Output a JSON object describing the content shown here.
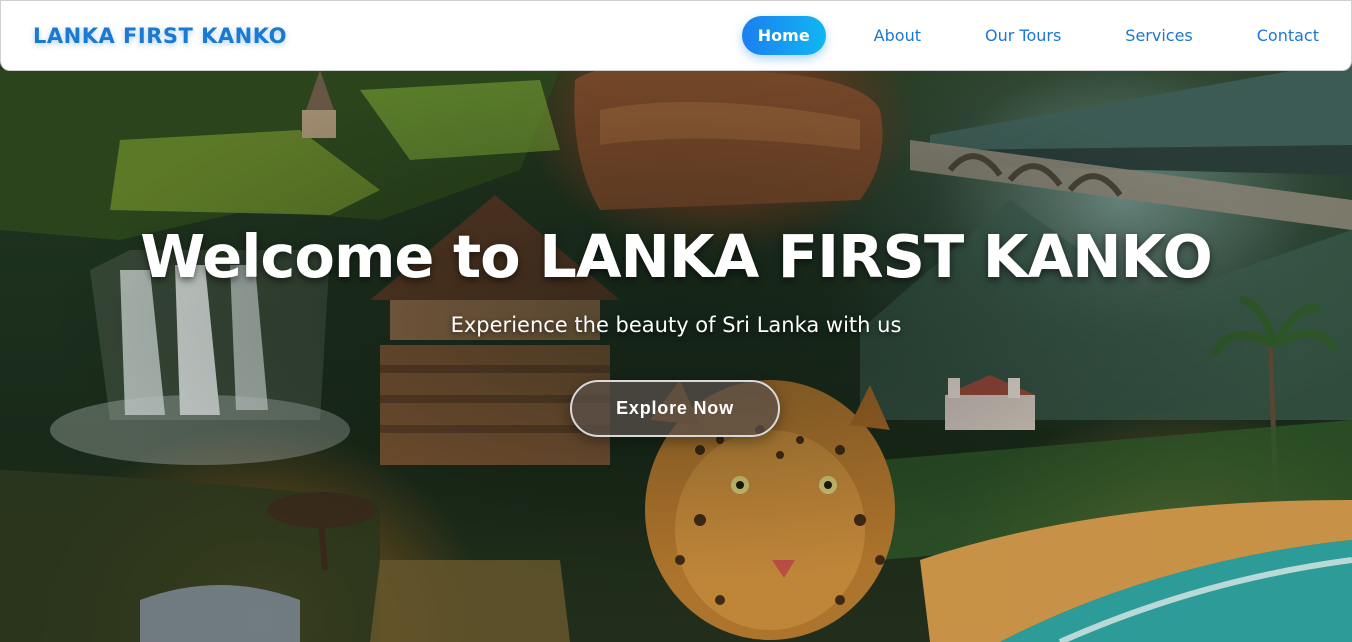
{
  "header": {
    "brand": "LANKA FIRST KANKO",
    "nav": [
      {
        "label": "Home",
        "active": true
      },
      {
        "label": "About",
        "active": false
      },
      {
        "label": "Our Tours",
        "active": false
      },
      {
        "label": "Services",
        "active": false
      },
      {
        "label": "Contact",
        "active": false
      }
    ]
  },
  "hero": {
    "title": "Welcome to LANKA FIRST KANKO",
    "subtitle": "Experience the beauty of Sri Lanka with us",
    "cta_label": "Explore Now",
    "background_icon": "sri-lanka-collage-image"
  },
  "colors": {
    "brand_blue": "#1b78d3",
    "active_gradient_start": "#1b7ff0",
    "active_gradient_end": "#11b6f2",
    "text_on_hero": "#ffffff"
  }
}
